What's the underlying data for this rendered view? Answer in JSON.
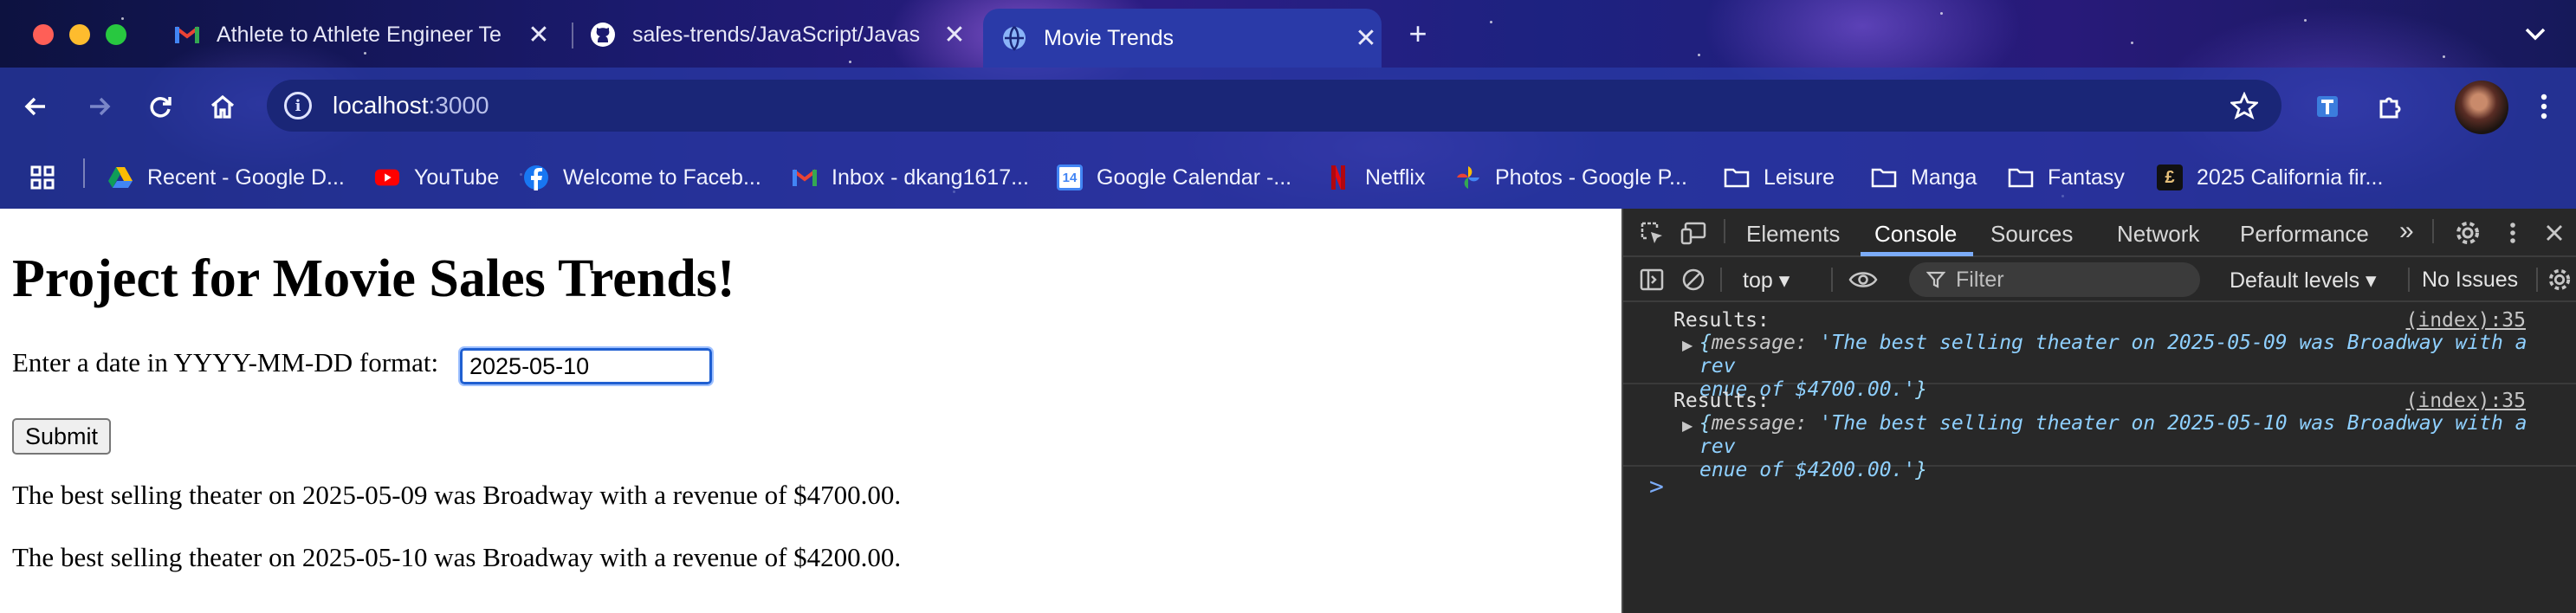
{
  "browser": {
    "tabs": [
      {
        "title": "Athlete to Athlete Engineer Te",
        "icon": "gmail-icon"
      },
      {
        "title": "sales-trends/JavaScript/Javas",
        "icon": "github-icon"
      },
      {
        "title": "Movie Trends",
        "icon": "globe-icon",
        "active": true
      }
    ],
    "new_tab_glyph": "+",
    "close_glyph": "✕",
    "address": {
      "host": "localhost",
      "port": ":3000"
    },
    "bookmarks": [
      {
        "label": "Recent - Google D...",
        "icon": "google-drive-icon"
      },
      {
        "label": "YouTube",
        "icon": "youtube-icon"
      },
      {
        "label": "Welcome to Faceb...",
        "icon": "facebook-icon"
      },
      {
        "label": "Inbox - dkang1617...",
        "icon": "gmail-icon"
      },
      {
        "label": "Google Calendar -...",
        "icon": "calendar-icon",
        "badge": "14"
      },
      {
        "label": "Netflix",
        "icon": "netflix-icon"
      },
      {
        "label": "Photos - Google P...",
        "icon": "google-photos-icon"
      },
      {
        "label": "Leisure",
        "icon": "folder-icon"
      },
      {
        "label": "Manga",
        "icon": "folder-icon"
      },
      {
        "label": "Fantasy",
        "icon": "folder-icon"
      },
      {
        "label": "2025 California fir...",
        "icon": "site-icon"
      }
    ]
  },
  "page": {
    "heading": "Project for Movie Sales Trends!",
    "prompt": "Enter a date in YYYY-MM-DD format:",
    "date_value": "2025-05-10",
    "submit_label": "Submit",
    "results": [
      "The best selling theater on 2025-05-09 was Broadway with a revenue of $4700.00.",
      "The best selling theater on 2025-05-10 was Broadway with a revenue of $4200.00."
    ]
  },
  "devtools": {
    "tabs": [
      "Elements",
      "Console",
      "Sources",
      "Network",
      "Performance"
    ],
    "active_tab": "Console",
    "more_glyph": "»",
    "context": "top ▾",
    "filter_placeholder": "Filter",
    "levels": "Default levels ▾",
    "issues": "No Issues",
    "logs": [
      {
        "label": "Results:",
        "source": "(index):35",
        "key": "message",
        "line1": "'The best selling theater on 2025-05-09 was Broadway with a rev",
        "line2": "enue of $4700.00.'"
      },
      {
        "label": "Results:",
        "source": "(index):35",
        "key": "message",
        "line1": "'The best selling theater on 2025-05-10 was Broadway with a rev",
        "line2": "enue of $4200.00.'"
      }
    ],
    "prompt_glyph": ">"
  }
}
